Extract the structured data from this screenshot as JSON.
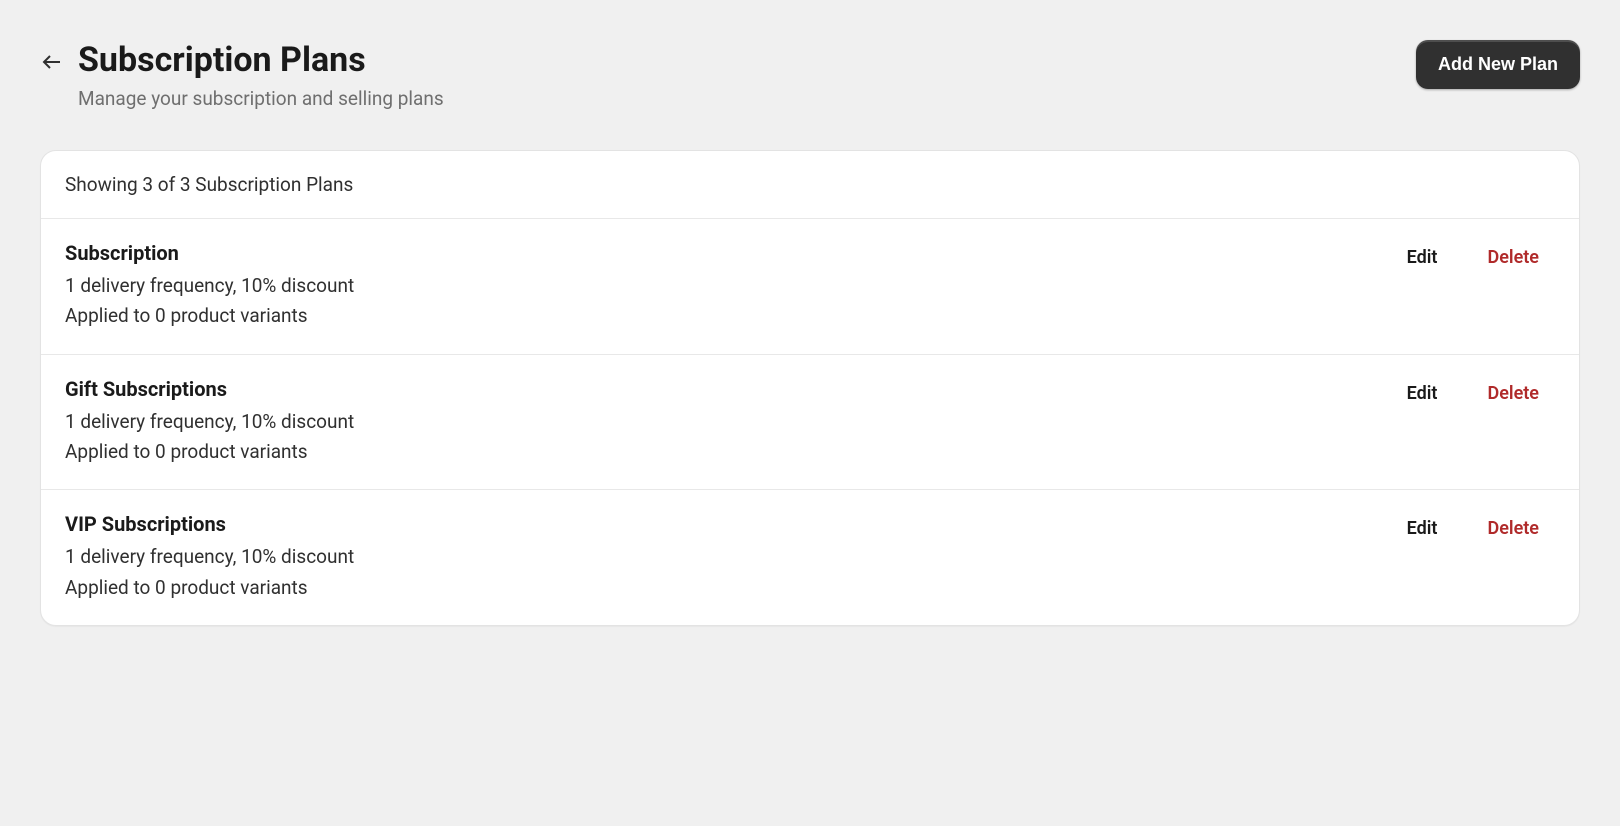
{
  "header": {
    "title": "Subscription Plans",
    "subtitle": "Manage your subscription and selling plans",
    "add_button_label": "Add New Plan"
  },
  "list": {
    "summary": "Showing 3 of 3 Subscription Plans",
    "edit_label": "Edit",
    "delete_label": "Delete",
    "plans": [
      {
        "name": "Subscription",
        "detail_line1": "1 delivery frequency, 10% discount",
        "detail_line2": "Applied to 0 product variants"
      },
      {
        "name": "Gift Subscriptions",
        "detail_line1": "1 delivery frequency, 10% discount",
        "detail_line2": "Applied to 0 product variants"
      },
      {
        "name": "VIP Subscriptions",
        "detail_line1": "1 delivery frequency, 10% discount",
        "detail_line2": "Applied to 0 product variants"
      }
    ]
  }
}
